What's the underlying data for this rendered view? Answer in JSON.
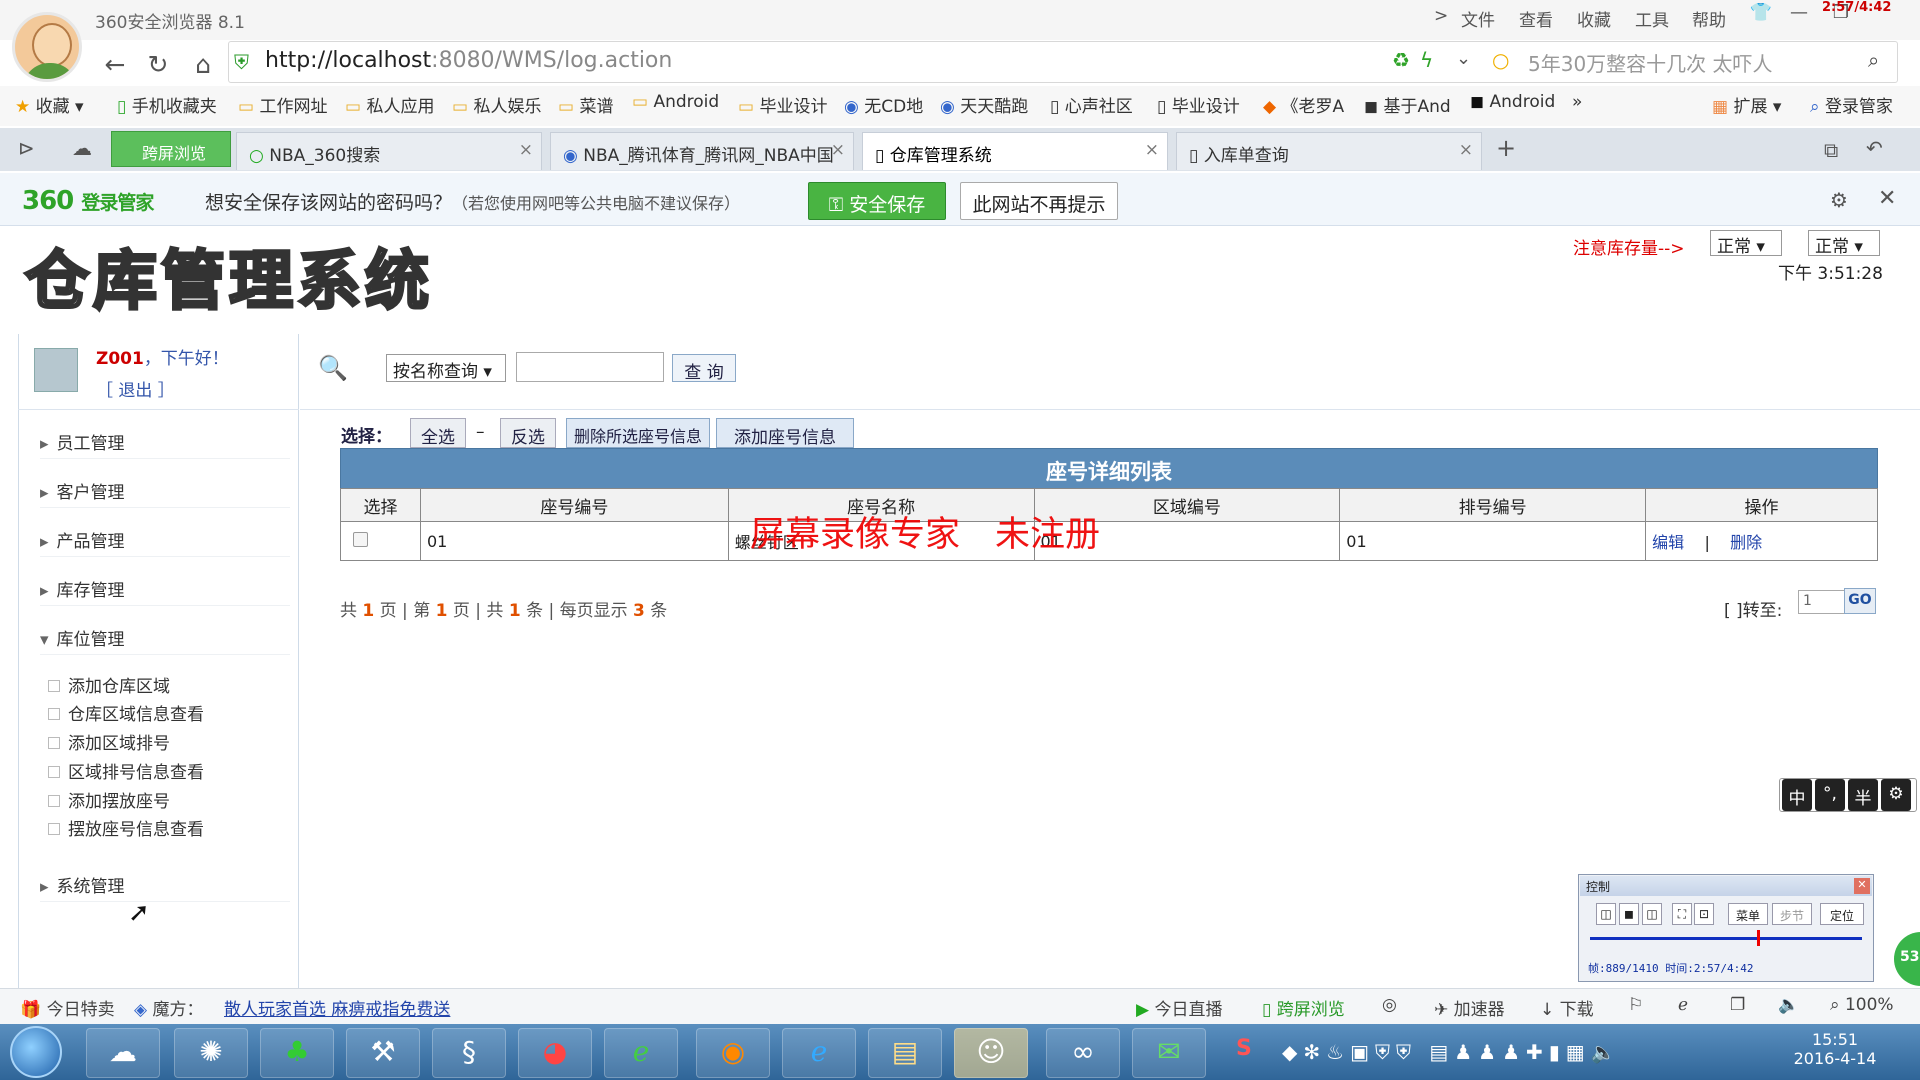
{
  "browser": {
    "title": "360安全浏览器 8.1",
    "menu": [
      "文件",
      "查看",
      "收藏",
      "工具",
      "帮助"
    ],
    "menu_arrow": ">",
    "recording_time": "2:57/4:42",
    "url_host": "http://localhost",
    "url_rest": ":8080/WMS/log.action",
    "search_placeholder": "5年30万整容十几次 太吓人",
    "bookmarks": [
      "收藏",
      "手机收藏夹",
      "工作网址",
      "私人应用",
      "私人娱乐",
      "菜谱",
      "Android",
      "毕业设计",
      "无CD地",
      "天天酷跑",
      "心声社区",
      "毕业设计",
      "《老罗A",
      "基于And",
      "Android",
      "扩展",
      "登录管家"
    ],
    "split_label": "跨屏浏览",
    "tabs": [
      {
        "label": "NBA_360搜索"
      },
      {
        "label": "NBA_腾讯体育_腾讯网_NBA中国"
      },
      {
        "label": "仓库管理系统"
      },
      {
        "label": "入库单查询"
      }
    ],
    "tab_close": "×",
    "new_tab": "+"
  },
  "pwdbar": {
    "brand": "360",
    "brand_sub": "登录管家",
    "question": "想安全保存该网站的密码吗？",
    "note": "（若您使用网吧等公共电脑不建议保存）",
    "save_label": "安全保存",
    "never_label": "此网站不再提示"
  },
  "app": {
    "title": "仓库管理系统",
    "warn": "注意库存量-->",
    "select1": "正常",
    "select2": "正常",
    "time": "下午 3:51:28"
  },
  "user": {
    "name": "Z001",
    "greeting": "，下午好！",
    "logout": "［ 退出 ］"
  },
  "nav": {
    "items": [
      "员工管理",
      "客户管理",
      "产品管理",
      "库存管理",
      "库位管理",
      "系统管理"
    ],
    "subitems": [
      "添加仓库区域",
      "仓库区域信息查看",
      "添加区域排号",
      "区域排号信息查看",
      "添加摆放座号",
      "摆放座号信息查看"
    ]
  },
  "search": {
    "mode": "按名称查询",
    "button": "查 询"
  },
  "toolbar": {
    "choose": "选择：",
    "select_all": "全选",
    "dash": "–",
    "invert": "反选",
    "delete_selected": "删除所选座号信息",
    "add_seat": "添加座号信息"
  },
  "table": {
    "title": "座号详细列表",
    "headers": [
      "选择",
      "座号编号",
      "座号名称",
      "区域编号",
      "排号编号",
      "操作"
    ],
    "rows": [
      {
        "seat_no": "01",
        "seat_name": "螺丝钉区",
        "area_no": "01",
        "row_no": "01",
        "edit": "编辑",
        "sep": "|",
        "delete": "删除"
      }
    ]
  },
  "watermark": "屏幕录像专家　未注册",
  "pager": {
    "p1": "共",
    "total_pages": "1",
    "p2": "页 | 第",
    "current": "1",
    "p3": "页 | 共",
    "count": "1",
    "p4": "条 | 每页显示",
    "per_page": "3",
    "p5": "条",
    "jump_label": "[ ]转至:",
    "jump_value": "1",
    "go": "GO"
  },
  "ime": [
    "中",
    "°,",
    "半",
    "⚙"
  ],
  "recorder": {
    "title": "控制",
    "btn_menu": "菜单",
    "btn_step": "步节",
    "btn_locate": "定位",
    "info": "帧:889/1410 时间:2:57/4:42"
  },
  "badge": "53",
  "statusbar": {
    "today_deal": "今日特卖",
    "magic": "魔方：",
    "promo": "散人玩家首选 麻痹戒指免费送",
    "live": "今日直播",
    "split": "跨屏浏览",
    "accelerator": "加速器",
    "download": "下载",
    "zoom": "100%"
  },
  "taskbar": {
    "time": "15:51",
    "date": "2016-4-14"
  }
}
